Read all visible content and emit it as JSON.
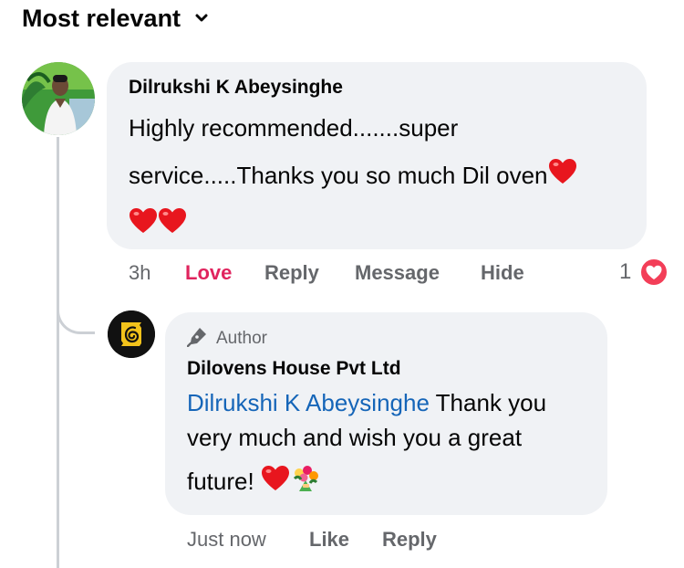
{
  "sort": {
    "label": "Most relevant"
  },
  "comment": {
    "author": "Dilrukshi K Abeysinghe",
    "text_line1": "Highly recommended.......super",
    "text_line2": "service.....Thanks you so much Dil oven",
    "time": "3h",
    "actions": {
      "love": "Love",
      "reply": "Reply",
      "message": "Message",
      "hide": "Hide"
    },
    "reaction_count": "1"
  },
  "reply": {
    "badge": "Author",
    "author": "Dilovens House Pvt Ltd",
    "mention": "Dilrukshi K Abeysinghe",
    "text_part1": " Thank you",
    "text_part2": "very much and wish you a great",
    "text_part3": "future!",
    "time": "Just now",
    "actions": {
      "like": "Like",
      "reply": "Reply"
    }
  },
  "colors": {
    "love": "#e0245e",
    "mention": "#1565b8",
    "bubble": "#f0f2f5",
    "muted": "#65676b"
  },
  "icons": [
    "chevron-down-icon",
    "heart-emoji-icon",
    "pen-icon",
    "bouquet-emoji-icon",
    "love-reaction-icon",
    "company-logo-icon"
  ]
}
